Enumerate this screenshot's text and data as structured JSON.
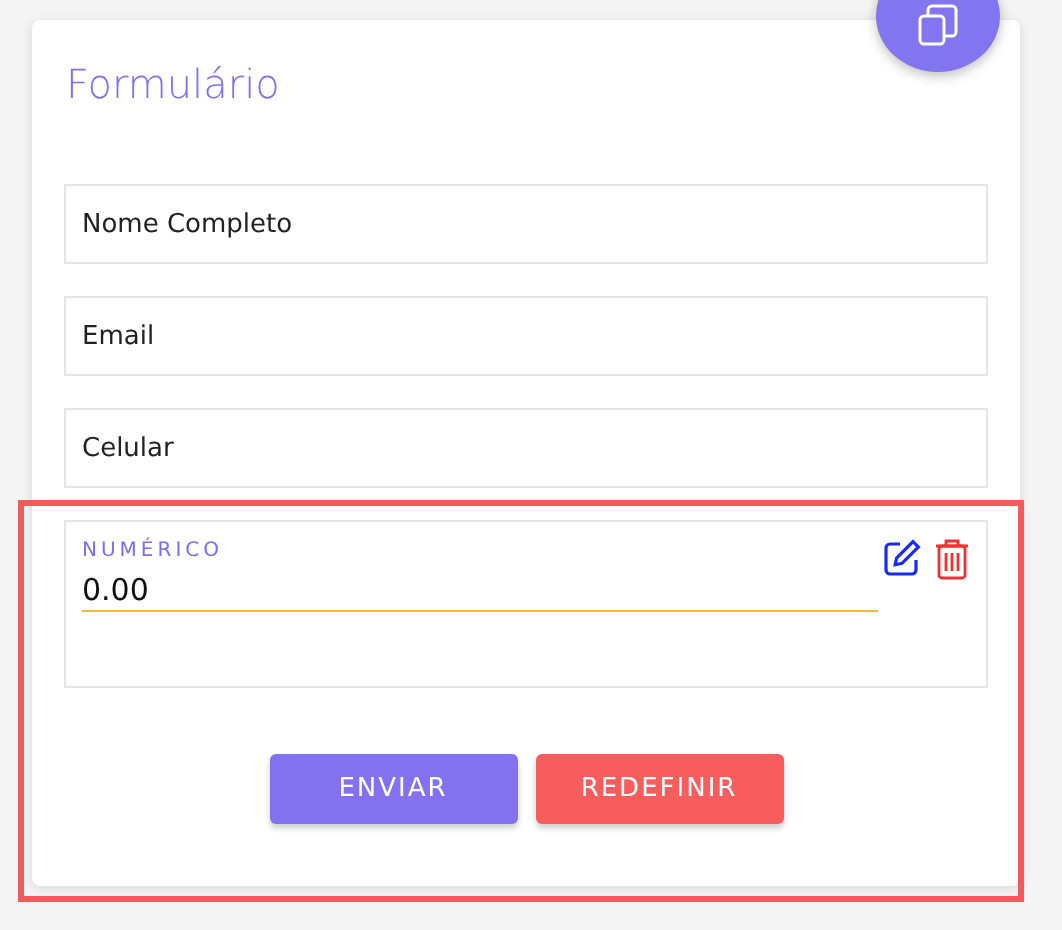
{
  "form": {
    "title": "Formulário",
    "fields": [
      {
        "placeholder": "Nome Completo"
      },
      {
        "placeholder": "Email"
      },
      {
        "placeholder": "Celular"
      }
    ],
    "numeric_block": {
      "selected": true,
      "label": "NUMÉRICO",
      "value": "0.00"
    },
    "buttons": [
      {
        "label": "ENVIAR",
        "kind": "submit"
      },
      {
        "label": "REDEFINIR",
        "kind": "reset"
      }
    ]
  }
}
